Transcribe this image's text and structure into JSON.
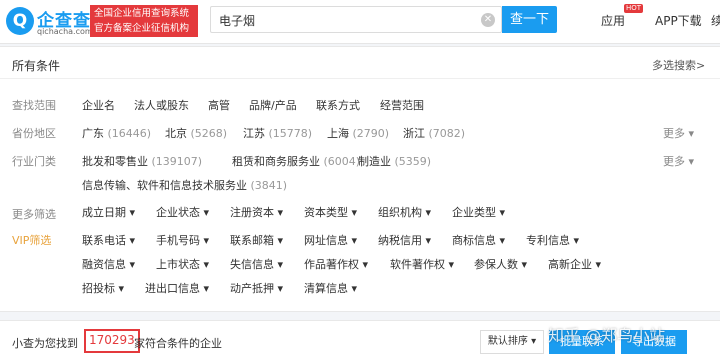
{
  "header": {
    "logo_glyph": "Q",
    "logo_name": "企查查",
    "logo_domain": "qichacha.com",
    "slogan_line1": "全国企业信用查询系统",
    "slogan_line2": "官方备案企业征信机构",
    "search_value": "电子烟",
    "clear_glyph": "✕",
    "search_button": "查一下",
    "nav_app": "应用",
    "nav_badge": "HOT",
    "nav_download": "APP下载",
    "nav_more": "续"
  },
  "panel": {
    "title": "所有条件",
    "multi_search": "多选搜索>"
  },
  "rows": {
    "scope": {
      "label": "查找范围",
      "options": [
        "企业名",
        "法人或股东",
        "高管",
        "品牌/产品",
        "联系方式",
        "经营范围"
      ]
    },
    "province": {
      "label": "省份地区",
      "options": [
        {
          "name": "广东",
          "count": "(16446)"
        },
        {
          "name": "北京",
          "count": "(5268)"
        },
        {
          "name": "江苏",
          "count": "(15778)"
        },
        {
          "name": "上海",
          "count": "(2790)"
        },
        {
          "name": "浙江",
          "count": "(7082)"
        }
      ],
      "more": "更多 ▾"
    },
    "industry": {
      "label": "行业门类",
      "options": [
        {
          "name": "批发和零售业",
          "count": "(139107)"
        },
        {
          "name": "租赁和商务服务业",
          "count": "(6004)"
        },
        {
          "name": "制造业",
          "count": "(5359)"
        },
        {
          "name": "信息传输、软件和信息技术服务业",
          "count": "(3841)"
        }
      ],
      "more": "更多 ▾"
    },
    "more_filters": {
      "label": "更多筛选",
      "options": [
        "成立日期 ▾",
        "企业状态 ▾",
        "注册资本 ▾",
        "资本类型 ▾",
        "组织机构 ▾",
        "企业类型 ▾"
      ]
    },
    "vip": {
      "label": "VIP筛选",
      "row1": [
        "联系电话 ▾",
        "手机号码 ▾",
        "联系邮箱 ▾",
        "网址信息 ▾",
        "纳税信用 ▾",
        "商标信息 ▾",
        "专利信息 ▾"
      ],
      "row2": [
        "融资信息 ▾",
        "上市状态 ▾",
        "失信信息 ▾",
        "作品著作权 ▾",
        "软件著作权 ▾",
        "参保人数 ▾",
        "高新企业 ▾"
      ],
      "row3": [
        "招投标 ▾",
        "进出口信息 ▾",
        "动产抵押 ▾",
        "清算信息 ▾"
      ]
    }
  },
  "result": {
    "prefix": "小查为您找到",
    "count": "170293",
    "suffix": "家符合条件的企业",
    "sort": "默认排序 ▾",
    "batch": "批量联系",
    "export": "导出数据",
    "watermark": "知乎 @郑鸟小站"
  }
}
